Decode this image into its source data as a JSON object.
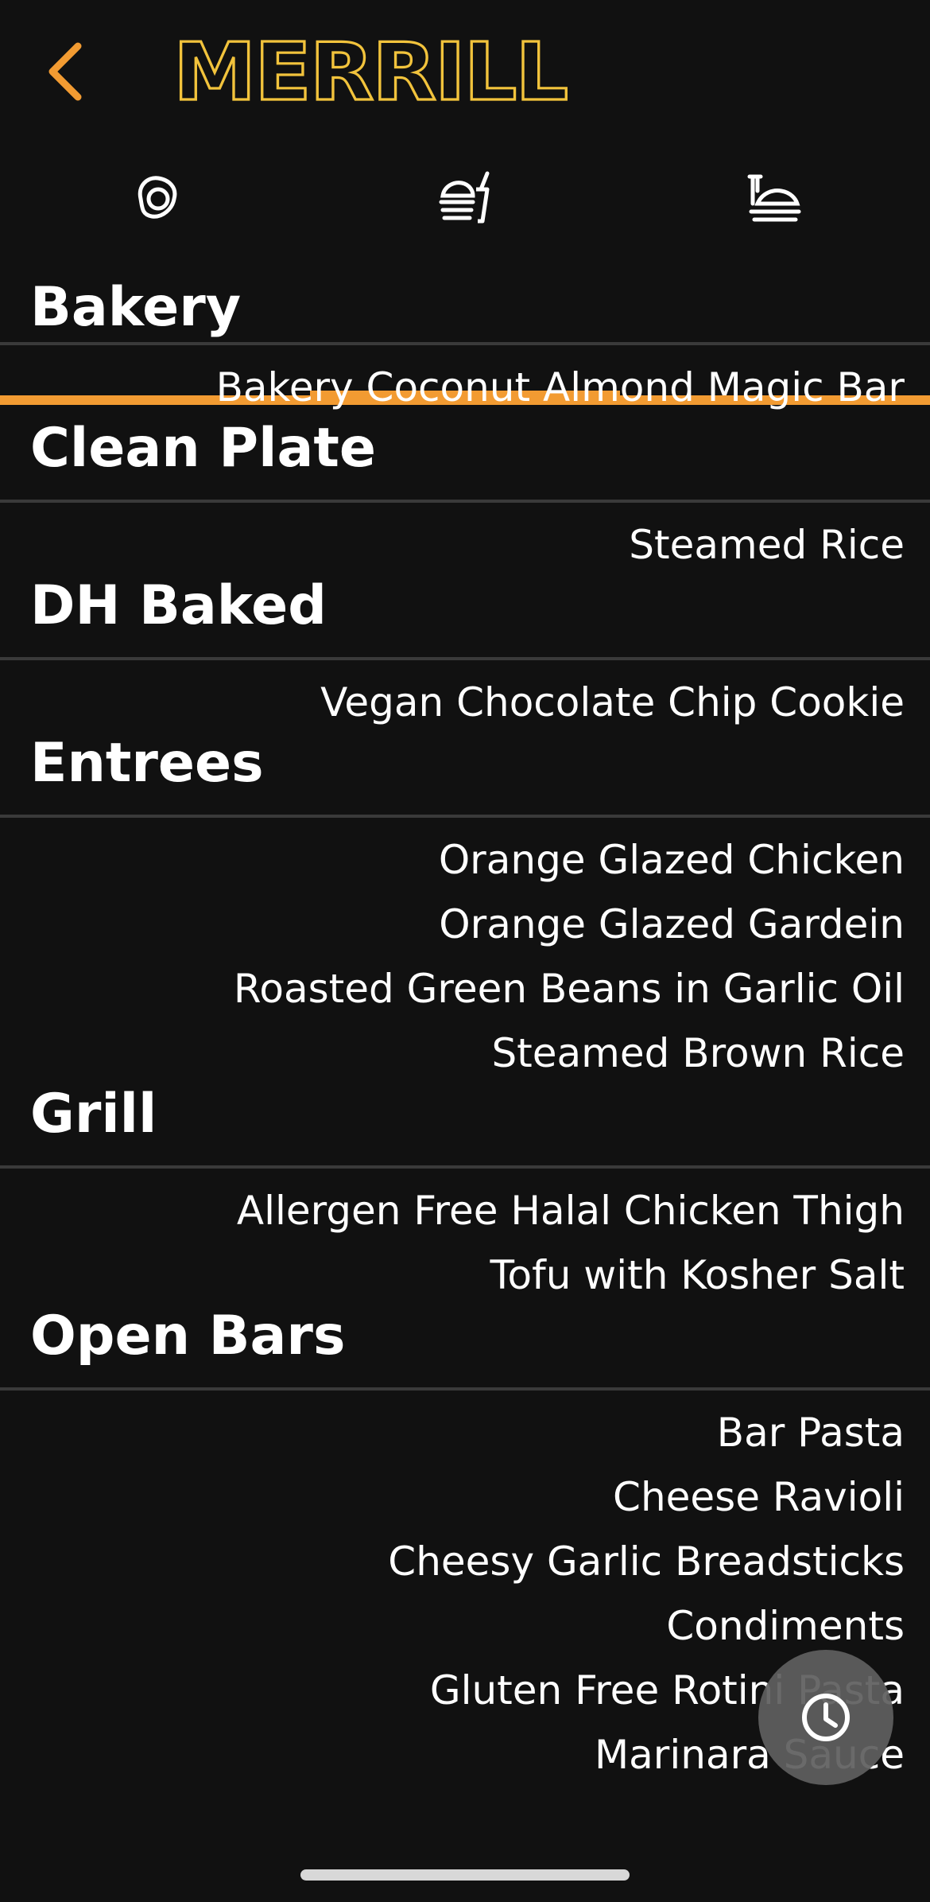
{
  "header": {
    "logo_text": "MERRILL",
    "accent_color": "#F29B32",
    "logo_color": "#F2C33C"
  },
  "tabs": [
    {
      "name": "breakfast",
      "icon": "egg-icon",
      "active": false
    },
    {
      "name": "lunch",
      "icon": "meal-icon",
      "active": true
    },
    {
      "name": "dinner",
      "icon": "dish-icon",
      "active": false
    }
  ],
  "sections": [
    {
      "title": "Bakery",
      "items": [
        "Bakery Coconut Almond Magic Bar"
      ]
    },
    {
      "title": "Clean Plate",
      "items": [
        "Steamed Rice"
      ]
    },
    {
      "title": "DH Baked",
      "items": [
        "Vegan Chocolate Chip Cookie"
      ]
    },
    {
      "title": "Entrees",
      "items": [
        "Orange Glazed Chicken",
        "Orange Glazed Gardein",
        "Roasted Green Beans in Garlic Oil",
        "Steamed Brown Rice"
      ]
    },
    {
      "title": "Grill",
      "items": [
        "Allergen Free Halal Chicken Thigh",
        "Tofu with Kosher Salt"
      ]
    },
    {
      "title": "Open Bars",
      "items": [
        "Bar Pasta",
        "Cheese Ravioli",
        "Cheesy Garlic Breadsticks",
        "Condiments",
        "Gluten Free Rotini Pasta",
        "Marinara Sauce"
      ]
    }
  ],
  "fab": {
    "icon": "clock-icon"
  }
}
